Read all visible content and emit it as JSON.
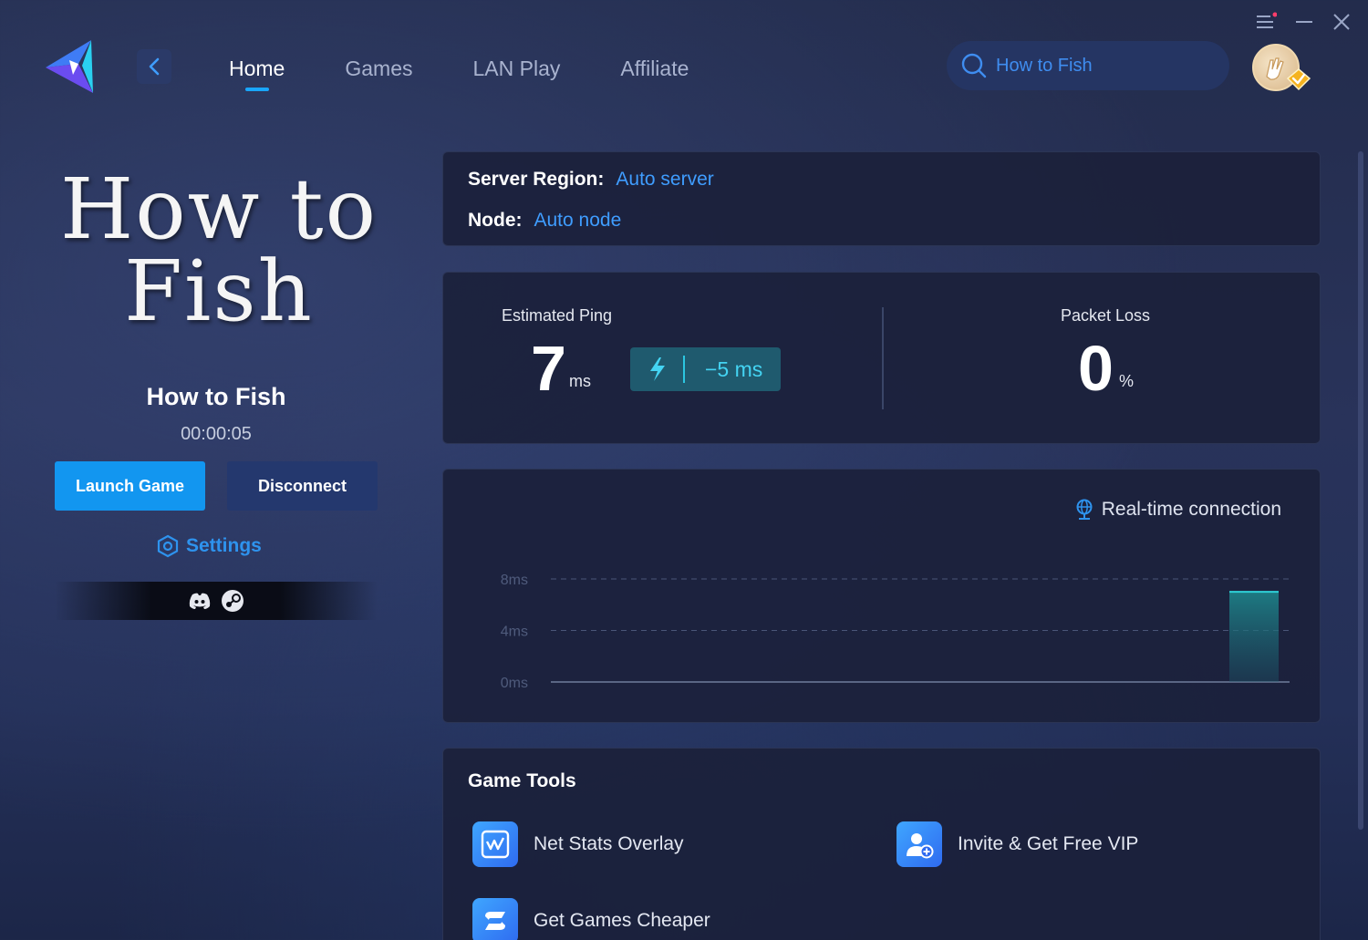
{
  "nav": {
    "tabs": [
      {
        "label": "Home",
        "active": true
      },
      {
        "label": "Games",
        "active": false
      },
      {
        "label": "LAN Play",
        "active": false
      },
      {
        "label": "Affiliate",
        "active": false
      }
    ]
  },
  "search": {
    "value": "How to Fish"
  },
  "game": {
    "logo_text_line1": "How to",
    "logo_text_line2": "Fish",
    "title": "How to Fish",
    "elapsed": "00:00:05"
  },
  "actions": {
    "launch_label": "Launch Game",
    "disconnect_label": "Disconnect",
    "settings_label": "Settings"
  },
  "platforms": [
    "discord-icon",
    "steam-icon"
  ],
  "server": {
    "region_key": "Server Region:",
    "region_value": "Auto server",
    "node_key": "Node:",
    "node_value": "Auto node"
  },
  "stats": {
    "ping_label": "Estimated Ping",
    "ping_value": "7",
    "ping_unit": "ms",
    "boost_value": "−5 ms",
    "loss_label": "Packet Loss",
    "loss_value": "0",
    "loss_unit": "%"
  },
  "chart": {
    "connection_label": "Real-time connection"
  },
  "chart_data": {
    "type": "bar",
    "ylim": [
      0,
      8
    ],
    "y_ticks": [
      "8ms",
      "4ms",
      "0ms"
    ],
    "y_tick_values": [
      8,
      4,
      0
    ],
    "values": [
      7
    ],
    "grid": true
  },
  "tools": {
    "title": "Game Tools",
    "items": [
      {
        "label": "Net Stats Overlay",
        "icon": "net-stats-icon"
      },
      {
        "label": "Invite & Get Free VIP",
        "icon": "invite-user-icon"
      },
      {
        "label": "Get Games Cheaper",
        "icon": "cheaper-games-icon"
      }
    ]
  },
  "colors": {
    "accent": "#1296f0",
    "link": "#3f9dff",
    "boost": "#44d4f3",
    "chart_bar": "#1d7f86"
  }
}
